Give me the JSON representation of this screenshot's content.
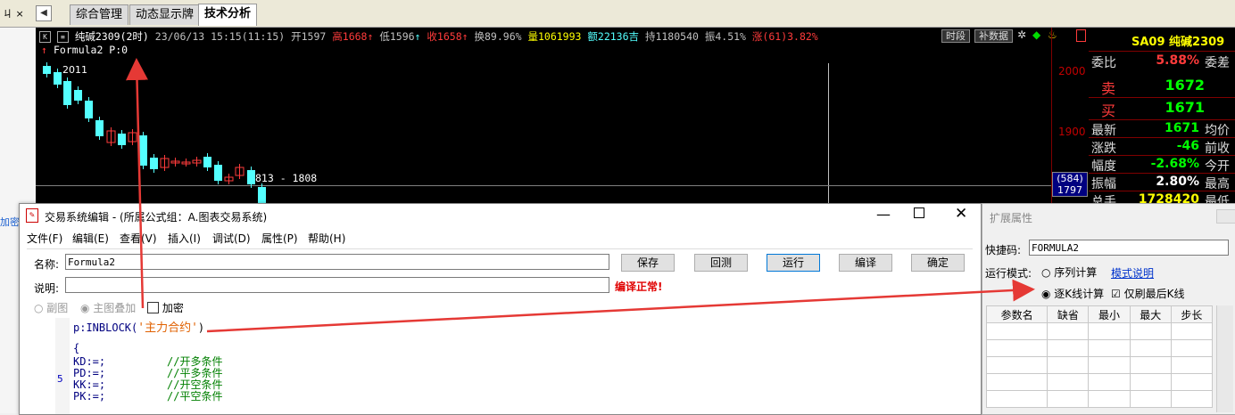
{
  "tabs": [
    "综合管理",
    "动态显示牌",
    "技术分析"
  ],
  "active_tab": 2,
  "left": {
    "pin_label": "ㄐ ×",
    "side_text": "加密"
  },
  "chart": {
    "symbol": "纯碱2309(2时)",
    "datetime": "23/06/13 15:15(11:15)",
    "open": "开1597",
    "high": "高1668",
    "low": "低1596",
    "close": "收1658",
    "turnover": "换89.96%",
    "volume": "量1061993",
    "amount": "额22136吉",
    "hold": "持1180540",
    "amplitude": "振4.51%",
    "change": "涨(61)3.82%",
    "btn_period": "时段",
    "btn_supplement": "补数据",
    "formula": "Formula2 P:0",
    "label_2011": "2011",
    "range_label": "813 - 1808",
    "price_2000": "2000",
    "price_1900": "1900",
    "side_tag_1": "(584)",
    "side_tag_2": "1797",
    "colors": {
      "up": "#ff3b3b",
      "down": "#54ffff",
      "text_gray": "#c0c0c0"
    }
  },
  "quote": {
    "code": "SA09 纯碱2309",
    "rows": [
      {
        "label": "委比",
        "value": "5.88%",
        "right": "委差",
        "color": "#ff3b3b"
      },
      {
        "label": "卖",
        "value": "1672",
        "right": "",
        "color": "#00ff00"
      },
      {
        "label": "买",
        "value": "1671",
        "right": "",
        "color": "#00ff00"
      },
      {
        "label": "最新",
        "value": "1671",
        "right": "均价",
        "color": "#00ff00"
      },
      {
        "label": "涨跌",
        "value": "-46",
        "right": "前收",
        "color": "#00ff00"
      },
      {
        "label": "幅度",
        "value": "-2.68%",
        "right": "今开",
        "color": "#00ff00"
      },
      {
        "label": "振幅",
        "value": "2.80%",
        "right": "最高",
        "color": "#ffffff"
      },
      {
        "label": "总手",
        "value": "1728420",
        "right": "最低",
        "color": "#ffff00"
      }
    ]
  },
  "dialog": {
    "title": "交易系统编辑 - (所属公式组：A.图表交易系统)",
    "menus": [
      "文件(F)",
      "编辑(E)",
      "查看(V)",
      "插入(I)",
      "调试(D)",
      "属性(P)",
      "帮助(H)"
    ],
    "name_label": "名称:",
    "name_value": "Formula2",
    "desc_label": "说明:",
    "desc_value": "",
    "buttons": {
      "save": "保存",
      "backtest": "回测",
      "run": "运行",
      "compile": "编译",
      "ok": "确定"
    },
    "compile_status": "编译正常!",
    "radio_sub": "副图",
    "radio_main": "主图叠加",
    "check_encrypt": "加密",
    "code_lines": [
      {
        "code": "p:INBLOCK(",
        "str": "'主力合约'",
        "tail": ")"
      },
      {
        "code": "",
        "str": "",
        "tail": ""
      },
      {
        "code": "{",
        "str": "",
        "tail": ""
      },
      {
        "code": "KD:=;",
        "comment": "//开多条件"
      },
      {
        "code": "PD:=;",
        "comment": "//平多条件"
      },
      {
        "code": "KK:=;",
        "comment": "//开空条件"
      },
      {
        "code": "PK:=;",
        "comment": "//平空条件"
      }
    ],
    "gutter_number": "5"
  },
  "ext": {
    "title": "扩展属性",
    "shortcut_label": "快捷码:",
    "shortcut_value": "FORMULA2",
    "mode_label": "运行模式:",
    "mode_seq": "序列计算",
    "mode_help": "模式说明",
    "mode_kline": "逐K线计算",
    "last_k": "仅刷最后K线",
    "headers": [
      "参数名",
      "缺省",
      "最小",
      "最大",
      "步长"
    ]
  }
}
